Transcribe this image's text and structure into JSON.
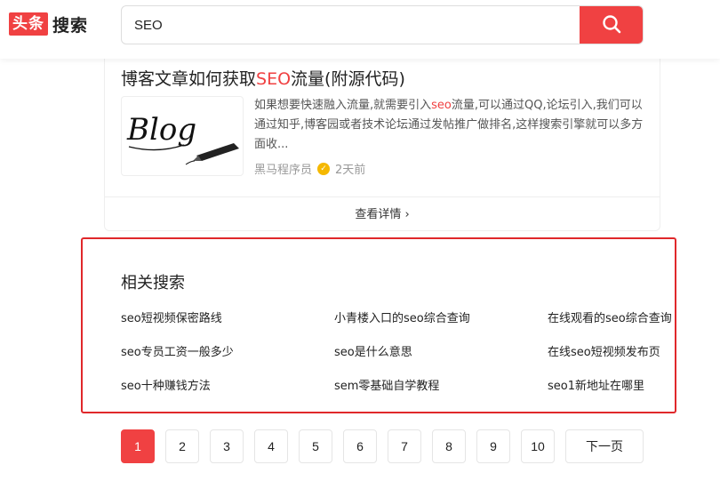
{
  "header": {
    "logo_box": "头条",
    "logo_text": "搜索",
    "search_value": "SEO"
  },
  "result": {
    "title_before": "博客文章如何获取",
    "title_highlight": "SEO",
    "title_after": "流量(附源代码)",
    "thumb_text": "Blog",
    "abstract_before": "如果想要快速融入流量,就需要引入",
    "abstract_highlight": "seo",
    "abstract_after": "流量,可以通过QQ,论坛引入,我们可以通过知乎,博客园或者技术论坛通过发帖推广做排名,这样搜索引擎就可以多方面收...",
    "author": "黑马程序员",
    "time": "2天前",
    "details_label": "查看详情",
    "details_arrow": "›"
  },
  "related": {
    "title": "相关搜索",
    "items": [
      "seo短视频保密路线",
      "小青楼入口的seo综合查询",
      "在线观看的seo综合查询",
      "seo专员工资一般多少",
      "seo是什么意思",
      "在线seo短视频发布页",
      "seo十种赚钱方法",
      "sem零基础自学教程",
      "seo1新地址在哪里"
    ]
  },
  "pagination": {
    "pages": [
      "1",
      "2",
      "3",
      "4",
      "5",
      "6",
      "7",
      "8",
      "9",
      "10"
    ],
    "current": "1",
    "next_label": "下一页"
  },
  "colors": {
    "brand_red": "#f04142",
    "highlight_border": "#e0282b"
  }
}
